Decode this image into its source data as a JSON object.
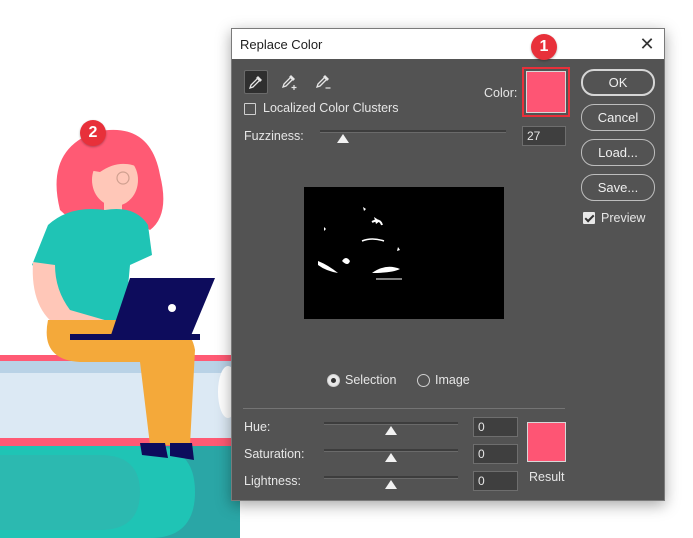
{
  "markers": {
    "first": "1",
    "second": "2"
  },
  "dialog": {
    "title": "Replace Color",
    "close_icon": "close-icon",
    "tools": [
      "eyedropper-icon",
      "eyedropper-plus-icon",
      "eyedropper-minus-icon"
    ],
    "localized_clusters_label": "Localized Color Clusters",
    "localized_clusters_checked": false,
    "color_label": "Color:",
    "color_hex": "#fe5574",
    "fuzziness_label": "Fuzziness:",
    "fuzziness_value": "27",
    "mode_options": {
      "selection": "Selection",
      "image": "Image"
    },
    "mode_selected": "Selection",
    "hue_label": "Hue:",
    "hue_value": "0",
    "saturation_label": "Saturation:",
    "saturation_value": "0",
    "lightness_label": "Lightness:",
    "lightness_value": "0",
    "result_label": "Result",
    "result_hex": "#fe5574"
  },
  "buttons": {
    "ok": "OK",
    "cancel": "Cancel",
    "load": "Load...",
    "save": "Save..."
  },
  "preview": {
    "label": "Preview",
    "checked": true
  },
  "colors": {
    "hair": "#ff5a74",
    "shirt": "#1fc4b5",
    "pants": "#f4a93a",
    "laptop": "#0d0c5c",
    "book_top": "#dce9f4",
    "book_bottom": "#1fc4b5",
    "dialog_bg": "#535353",
    "marker": "#e8303a"
  }
}
